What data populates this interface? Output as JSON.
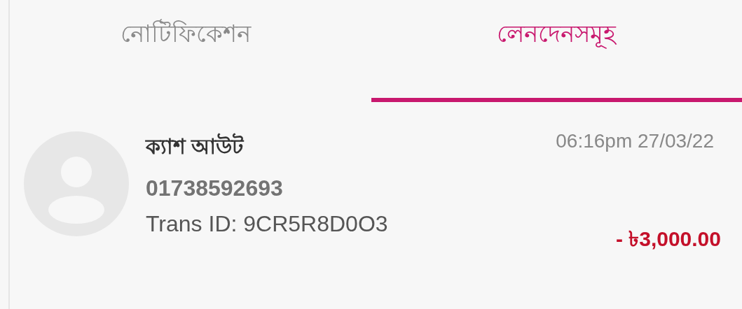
{
  "tabs": [
    {
      "label": "নোটিফিকেশন",
      "selected": false
    },
    {
      "label": "লেনদেনসমূহ",
      "selected": true
    }
  ],
  "transactions": [
    {
      "title": "ক্যাশ আউট",
      "number": "01738592693",
      "trans_id": "Trans ID: 9CR5R8D0O3",
      "time": "06:16pm 27/03/22",
      "amount": "- ৳3,000.00"
    }
  ]
}
